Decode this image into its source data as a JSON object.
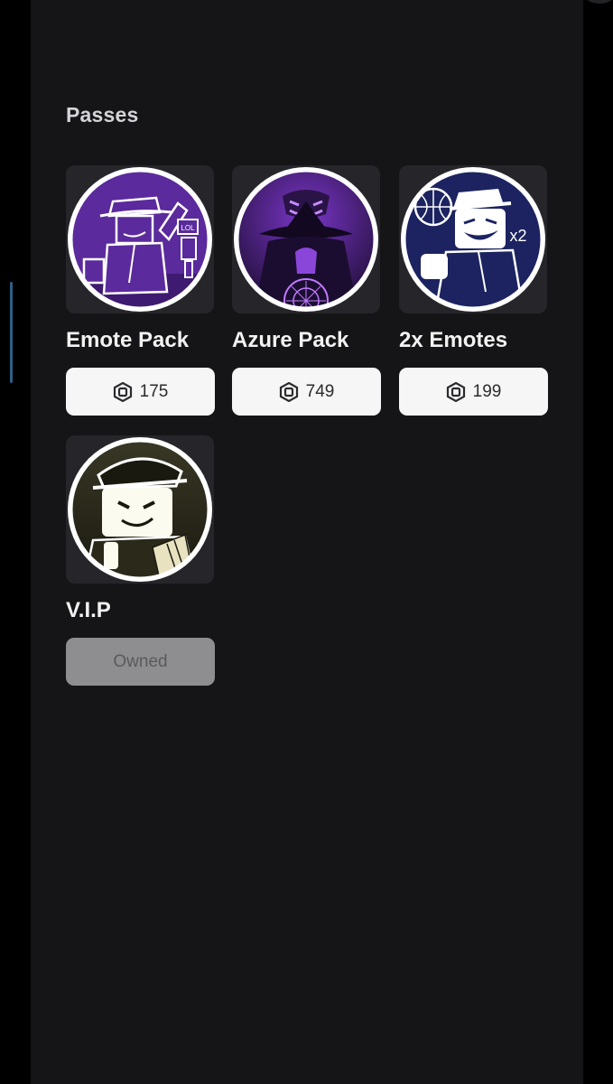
{
  "section": {
    "title": "Passes"
  },
  "currency_icon": "robux-icon",
  "passes": [
    {
      "name": "Emote Pack",
      "price": "175",
      "status": "buy",
      "icon": "emote-pack-thumbnail",
      "accent": "#5b2a9c"
    },
    {
      "name": "Azure Pack",
      "price": "749",
      "status": "buy",
      "icon": "azure-pack-thumbnail",
      "accent": "#7a36c8"
    },
    {
      "name": "2x Emotes",
      "price": "199",
      "status": "buy",
      "icon": "double-emotes-thumbnail",
      "accent": "#1c2360"
    },
    {
      "name": "V.I.P",
      "status_label": "Owned",
      "status": "owned",
      "icon": "vip-thumbnail",
      "accent": "#2b2a1a"
    }
  ],
  "thumbnail_texts": {
    "emote_pack_sign": "LOL",
    "double_emotes_mark": "x2"
  },
  "colors": {
    "panel_bg": "#151517",
    "card_bg": "#26262a",
    "price_button_bg": "#f6f6f6",
    "owned_button_bg": "#8e8e90"
  }
}
